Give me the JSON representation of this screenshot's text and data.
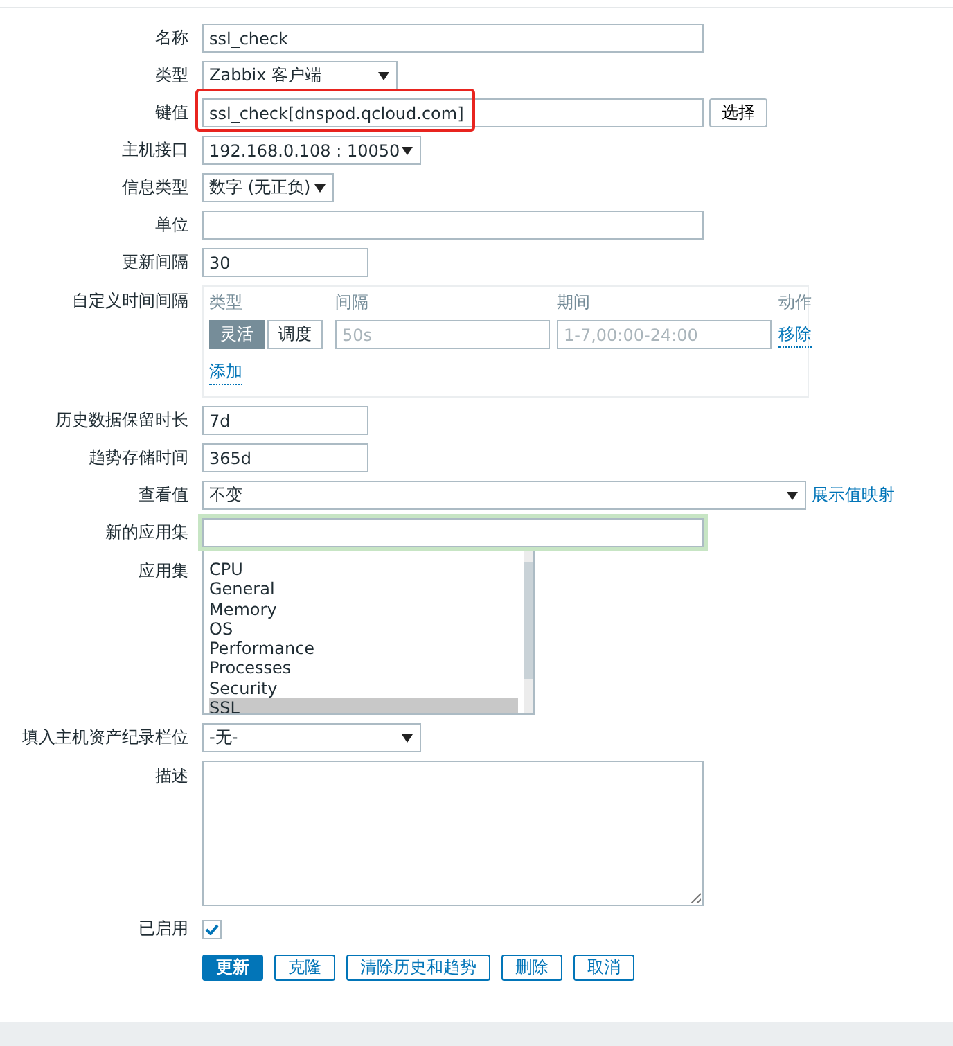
{
  "form": {
    "fields": [
      {
        "kind": "text",
        "label": "名称",
        "value": "ssl_check"
      },
      {
        "kind": "select",
        "label": "类型",
        "value": "Zabbix 客户端"
      },
      {
        "kind": "text",
        "label": "键值",
        "value": "ssl_check[dnspod.qcloud.com]",
        "highlighted": true,
        "button": "选择"
      },
      {
        "kind": "select",
        "label": "主机接口",
        "value": "192.168.0.108 : 10050"
      },
      {
        "kind": "select",
        "label": "信息类型",
        "value": "数字 (无正负)"
      },
      {
        "kind": "text",
        "label": "单位"
      },
      {
        "kind": "text",
        "label": "更新间隔",
        "value": "30"
      },
      {
        "kind": "intervals",
        "label": "自定义时间间隔",
        "columns": [
          "类型",
          "间隔",
          "期间",
          "动作"
        ],
        "rows": [
          {
            "modes": [
              {
                "label": "灵活",
                "selected": true
              },
              {
                "label": "调度",
                "selected": false
              }
            ],
            "interval_placeholder": "50s",
            "period_placeholder": "1-7,00:00-24:00",
            "action": "移除"
          }
        ],
        "add_link": "添加"
      },
      {
        "kind": "text",
        "label": "历史数据保留时长",
        "value": "7d"
      },
      {
        "kind": "text",
        "label": "趋势存储时间",
        "value": "365d"
      },
      {
        "kind": "select",
        "label": "查看值",
        "value": "不变",
        "link": "展示值映射"
      },
      {
        "kind": "text",
        "label": "新的应用集",
        "focused": true
      },
      {
        "kind": "listbox",
        "label": "应用集",
        "items": [
          {
            "label": "CPU",
            "selected": false
          },
          {
            "label": "General",
            "selected": false
          },
          {
            "label": "Memory",
            "selected": false
          },
          {
            "label": "OS",
            "selected": false
          },
          {
            "label": "Performance",
            "selected": false
          },
          {
            "label": "Processes",
            "selected": false
          },
          {
            "label": "Security",
            "selected": false
          },
          {
            "label": "SSL",
            "selected": true
          }
        ]
      },
      {
        "kind": "select",
        "label": "填入主机资产纪录栏位",
        "value": "-无-"
      },
      {
        "kind": "textarea",
        "label": "描述"
      },
      {
        "kind": "checkbox",
        "label": "已启用",
        "checked": true
      }
    ],
    "buttons": [
      {
        "label": "更新",
        "primary": true
      },
      {
        "label": "克隆",
        "primary": false
      },
      {
        "label": "清除历史和趋势",
        "primary": false
      },
      {
        "label": "删除",
        "primary": false
      },
      {
        "label": "取消",
        "primary": false
      }
    ]
  }
}
